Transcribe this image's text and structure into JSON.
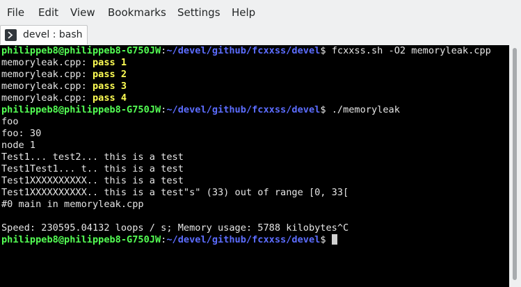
{
  "menubar": {
    "items": [
      "File",
      "Edit",
      "View",
      "Bookmarks",
      "Settings",
      "Help"
    ]
  },
  "tab": {
    "label": "devel : bash"
  },
  "terminal": {
    "prompt": {
      "user_host": "philippeb8@philippeb8-G750JW",
      "colon": ":",
      "path": "~/devel/github/fcxxss/devel",
      "dollar": "$"
    },
    "command1": " fcxxss.sh -O2 memoryleak.cpp",
    "pass_lines": [
      {
        "file": "memoryleak.cpp: ",
        "status": "pass 1"
      },
      {
        "file": "memoryleak.cpp: ",
        "status": "pass 2"
      },
      {
        "file": "memoryleak.cpp: ",
        "status": "pass 3"
      },
      {
        "file": "memoryleak.cpp: ",
        "status": "pass 4"
      }
    ],
    "command2": " ./memoryleak",
    "output": [
      "foo",
      "foo: 30",
      "node 1",
      "Test1... test2... this is a test",
      "Test1Test1... t.. this is a test",
      "Test1XXXXXXXXXX.. this is a test",
      "Test1XXXXXXXXXX.. this is a test\"s\" (33) out of range [0, 33[",
      "#0 main in memoryleak.cpp",
      "",
      "Speed: 230595.04132 loops / s; Memory usage: 5788 kilobytes^C"
    ],
    "colors": {
      "background": "#000000",
      "prompt_user": "#54ff54",
      "prompt_path": "#5c6dff",
      "pass": "#ffff54",
      "text": "#e6e6e6"
    }
  }
}
